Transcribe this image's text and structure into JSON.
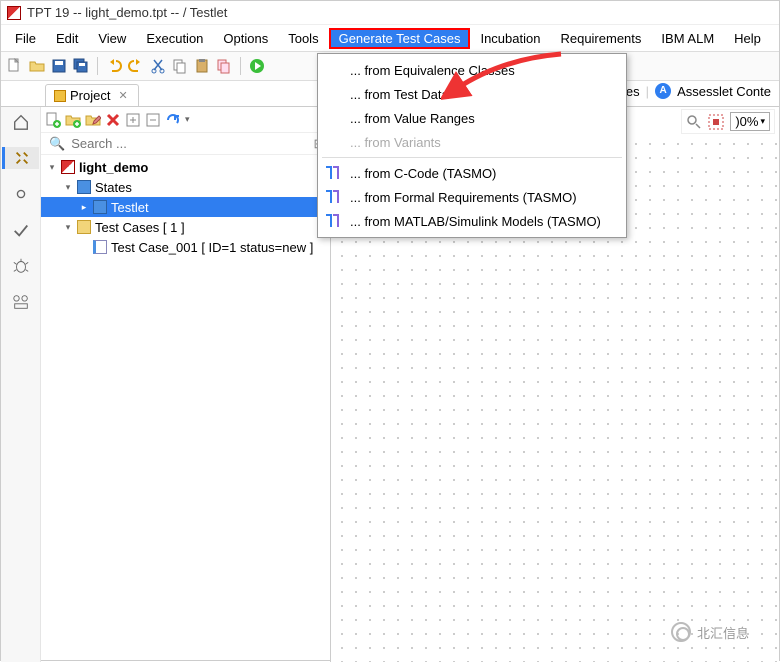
{
  "titlebar": {
    "title": "TPT 19 -- light_demo.tpt --  / Testlet"
  },
  "menubar": {
    "items": [
      "File",
      "Edit",
      "View",
      "Execution",
      "Options",
      "Tools",
      "Generate Test Cases",
      "Incubation",
      "Requirements",
      "IBM ALM",
      "Help"
    ],
    "highlighted_index": 6
  },
  "dropdown": {
    "items": [
      {
        "label": "... from Equivalence Classes",
        "icon": "",
        "disabled": false
      },
      {
        "label": "... from Test Data",
        "icon": "",
        "disabled": false
      },
      {
        "label": "... from Value Ranges",
        "icon": "",
        "disabled": false
      },
      {
        "label": "... from Variants",
        "icon": "",
        "disabled": true
      },
      {
        "label": "... from C-Code (TASMO)",
        "icon": "tasmo",
        "disabled": false
      },
      {
        "label": "... from Formal Requirements (TASMO)",
        "icon": "tasmo",
        "disabled": false
      },
      {
        "label": "... from MATLAB/Simulink Models (TASMO)",
        "icon": "tasmo",
        "disabled": false
      }
    ]
  },
  "project_tab": {
    "label": "Project"
  },
  "search": {
    "placeholder": "Search ..."
  },
  "right_extra": {
    "values_label": "lues",
    "assesslet_label": "Assesslet Conte"
  },
  "zoom": {
    "value": ")0%"
  },
  "tree": {
    "root": {
      "label": "light_demo"
    },
    "states": {
      "label": "States"
    },
    "testlet": {
      "label": "Testlet"
    },
    "testcases": {
      "label": "Test Cases  [ 1 ]"
    },
    "testcase1": {
      "label": "Test Case_001  [ ID=1 status=new ]"
    }
  },
  "watermark": {
    "text": "北汇信息"
  }
}
